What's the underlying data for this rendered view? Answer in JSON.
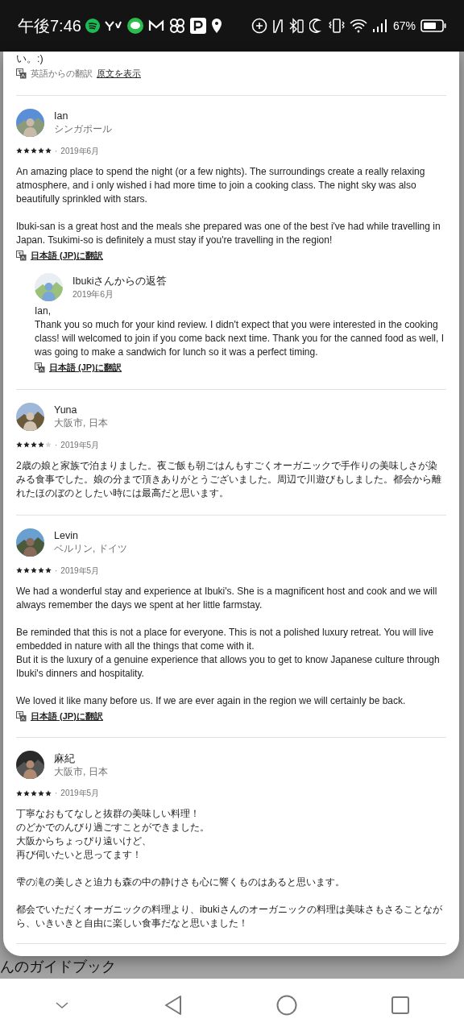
{
  "status_bar": {
    "time": "午後7:46",
    "battery": "67%"
  },
  "background": {
    "heading_fragment": "んのガイドブック"
  },
  "previous_review": {
    "text_end": "い。:)",
    "translation_note": "英語からの翻訳",
    "original_link": "原文を表示"
  },
  "reviews": [
    {
      "name": "Ian",
      "location": "シンガポール",
      "stars": 5,
      "separator": "·",
      "date": "2019年6月",
      "paragraphs": [
        [
          "An amazing place to spend the night (or a few nights). The surroundings create a really relaxing atmosphere, and i only wished i had more time to join a cooking class. The night sky was also beautifully sprinkled with stars."
        ],
        [
          "Ibuki-san is a great host and the meals she prepared was one of the best i've had while travelling in Japan. Tsukimi-so is definitely a must stay if you're travelling in the region!"
        ]
      ],
      "translate_link": "日本語 (JP)に翻訳",
      "reply": {
        "title": "Ibukiさんからの返答",
        "date": "2019年6月",
        "lines": [
          "Ian,",
          "Thank you so much for your kind review. I didn't expect that you were interested in the cooking class! will welcomed to join if you come back next time. Thank you for the canned food as well, I was going to make a sandwich for lunch so it was a perfect timing."
        ],
        "translate_link": "日本語 (JP)に翻訳"
      }
    },
    {
      "name": "Yuna",
      "location": "大阪市, 日本",
      "stars": 4,
      "separator": "·",
      "date": "2019年5月",
      "paragraphs": [
        [
          "2歳の娘と家族で泊まりました。夜ご飯も朝ごはんもすごくオーガニックで手作りの美味しさが染みる食事でした。娘の分まで頂きありがとうございました。周辺で川遊びもしました。都会から離れたほのぼのとしたい時には最高だと思います。"
        ]
      ]
    },
    {
      "name": "Levin",
      "location": "ベルリン, ドイツ",
      "stars": 5,
      "separator": "·",
      "date": "2019年5月",
      "paragraphs": [
        [
          "We had a wonderful stay and experience at Ibuki's. She is a magnificent host and cook and we will always remember the days we spent at her little farmstay."
        ],
        [
          "Be reminded that this is not a place for everyone. This is not a polished luxury retreat. You will live embedded in nature with all the things that come with it.",
          "But it is the luxury of a genuine experience that allows you to get to know Japanese culture through Ibuki's dinners and hospitality."
        ],
        [
          "We loved it like many before us. If we are ever again in the region we will certainly be back."
        ]
      ],
      "translate_link": "日本語 (JP)に翻訳"
    },
    {
      "name": "麻紀",
      "location": "大阪市, 日本",
      "stars": 5,
      "separator": "·",
      "date": "2019年5月",
      "paragraphs": [
        [
          "丁寧なおもてなしと抜群の美味しい料理！",
          "のどかでのんびり過ごすことができました。",
          "大阪からちょっぴり遠いけど、",
          "再び伺いたいと思ってます！"
        ],
        [
          "雫の滝の美しさと迫力も森の中の静けさも心に響くものはあると思います。"
        ],
        [
          "都会でいただくオーガニックの料理より、ibukiさんのオーガニックの料理は美味さもさることながら、いきいきと自由に楽しい食事だなと思いました！"
        ]
      ]
    }
  ]
}
